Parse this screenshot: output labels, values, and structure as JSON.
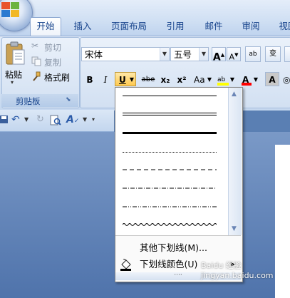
{
  "tabs": [
    {
      "label": "开始",
      "active": true
    },
    {
      "label": "插入",
      "active": false
    },
    {
      "label": "页面布局",
      "active": false
    },
    {
      "label": "引用",
      "active": false
    },
    {
      "label": "邮件",
      "active": false
    },
    {
      "label": "审阅",
      "active": false
    },
    {
      "label": "视图",
      "active": false
    }
  ],
  "clipboard": {
    "paste_label": "粘贴",
    "cut_label": "剪切",
    "copy_label": "复制",
    "format_painter_label": "格式刷",
    "group_label": "剪贴板"
  },
  "font": {
    "font_name": "宋体",
    "font_size": "五号",
    "bold": "B",
    "italic": "I",
    "underline": "U",
    "strikethrough": "abe",
    "subscript": "x₂",
    "superscript": "x²",
    "change_case": "Aa",
    "grow_font": "A",
    "shrink_font": "A",
    "clear_format_text": "ab",
    "phonetic": "变",
    "highlight_text": "ab",
    "font_color_text": "A",
    "char_shading": "A"
  },
  "underline_menu": {
    "styles": [
      "single",
      "double",
      "thick",
      "dotted",
      "dashed",
      "dash-dot",
      "dash-dot-dot",
      "wave"
    ],
    "more_underlines": "其他下划线(M)...",
    "underline_color": "下划线颜色(U)",
    "grip": "····"
  },
  "colors": {
    "accent": "#15428b",
    "highlight_yellow": "#ffff00",
    "font_color_red": "#ff0000"
  },
  "watermark": "Baidu 经验 jingyan.baidu.com"
}
